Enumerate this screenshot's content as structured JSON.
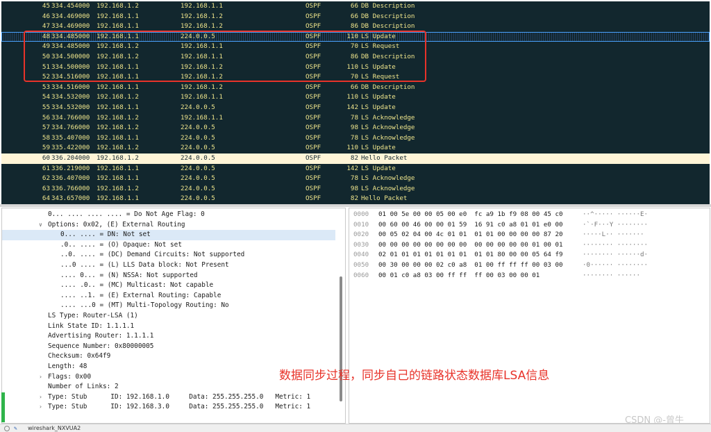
{
  "packets": [
    {
      "no": "45",
      "time": "334.454000",
      "src": "192.168.1.2",
      "dst": "192.168.1.1",
      "proto": "OSPF",
      "len": "66",
      "info": "DB Description"
    },
    {
      "no": "46",
      "time": "334.469000",
      "src": "192.168.1.1",
      "dst": "192.168.1.2",
      "proto": "OSPF",
      "len": "66",
      "info": "DB Description"
    },
    {
      "no": "47",
      "time": "334.469000",
      "src": "192.168.1.1",
      "dst": "192.168.1.2",
      "proto": "OSPF",
      "len": "86",
      "info": "DB Description"
    },
    {
      "no": "48",
      "time": "334.485000",
      "src": "192.168.1.1",
      "dst": "224.0.0.5",
      "proto": "OSPF",
      "len": "110",
      "info": "LS Update"
    },
    {
      "no": "49",
      "time": "334.485000",
      "src": "192.168.1.2",
      "dst": "192.168.1.1",
      "proto": "OSPF",
      "len": "70",
      "info": "LS Request"
    },
    {
      "no": "50",
      "time": "334.500000",
      "src": "192.168.1.2",
      "dst": "192.168.1.1",
      "proto": "OSPF",
      "len": "86",
      "info": "DB Description"
    },
    {
      "no": "51",
      "time": "334.500000",
      "src": "192.168.1.1",
      "dst": "192.168.1.2",
      "proto": "OSPF",
      "len": "110",
      "info": "LS Update"
    },
    {
      "no": "52",
      "time": "334.516000",
      "src": "192.168.1.1",
      "dst": "192.168.1.2",
      "proto": "OSPF",
      "len": "70",
      "info": "LS Request"
    },
    {
      "no": "53",
      "time": "334.516000",
      "src": "192.168.1.1",
      "dst": "192.168.1.2",
      "proto": "OSPF",
      "len": "66",
      "info": "DB Description"
    },
    {
      "no": "54",
      "time": "334.532000",
      "src": "192.168.1.2",
      "dst": "192.168.1.1",
      "proto": "OSPF",
      "len": "110",
      "info": "LS Update"
    },
    {
      "no": "55",
      "time": "334.532000",
      "src": "192.168.1.1",
      "dst": "224.0.0.5",
      "proto": "OSPF",
      "len": "142",
      "info": "LS Update"
    },
    {
      "no": "56",
      "time": "334.766000",
      "src": "192.168.1.2",
      "dst": "192.168.1.1",
      "proto": "OSPF",
      "len": "78",
      "info": "LS Acknowledge"
    },
    {
      "no": "57",
      "time": "334.766000",
      "src": "192.168.1.2",
      "dst": "224.0.0.5",
      "proto": "OSPF",
      "len": "98",
      "info": "LS Acknowledge"
    },
    {
      "no": "58",
      "time": "335.407000",
      "src": "192.168.1.1",
      "dst": "224.0.0.5",
      "proto": "OSPF",
      "len": "78",
      "info": "LS Acknowledge"
    },
    {
      "no": "59",
      "time": "335.422000",
      "src": "192.168.1.2",
      "dst": "224.0.0.5",
      "proto": "OSPF",
      "len": "110",
      "info": "LS Update"
    },
    {
      "no": "60",
      "time": "336.204000",
      "src": "192.168.1.2",
      "dst": "224.0.0.5",
      "proto": "OSPF",
      "len": "82",
      "info": "Hello Packet"
    },
    {
      "no": "61",
      "time": "336.219000",
      "src": "192.168.1.1",
      "dst": "224.0.0.5",
      "proto": "OSPF",
      "len": "142",
      "info": "LS Update"
    },
    {
      "no": "62",
      "time": "336.407000",
      "src": "192.168.1.1",
      "dst": "224.0.0.5",
      "proto": "OSPF",
      "len": "78",
      "info": "LS Acknowledge"
    },
    {
      "no": "63",
      "time": "336.766000",
      "src": "192.168.1.2",
      "dst": "224.0.0.5",
      "proto": "OSPF",
      "len": "98",
      "info": "LS Acknowledge"
    },
    {
      "no": "64",
      "time": "343.657000",
      "src": "192.168.1.1",
      "dst": "224.0.0.5",
      "proto": "OSPF",
      "len": "82",
      "info": "Hello Packet"
    }
  ],
  "details": [
    {
      "indent": 1,
      "twisty": "",
      "text": "0... .... .... .... = Do Not Age Flag: 0"
    },
    {
      "indent": 0,
      "twisty": "v",
      "text": "Options: 0x02, (E) External Routing"
    },
    {
      "indent": 2,
      "twisty": "",
      "text": "0... .... = DN: Not set"
    },
    {
      "indent": 2,
      "twisty": "",
      "text": ".0.. .... = (O) Opaque: Not set"
    },
    {
      "indent": 2,
      "twisty": "",
      "text": "..0. .... = (DC) Demand Circuits: Not supported"
    },
    {
      "indent": 2,
      "twisty": "",
      "text": "...0 .... = (L) LLS Data block: Not Present"
    },
    {
      "indent": 2,
      "twisty": "",
      "text": ".... 0... = (N) NSSA: Not supported"
    },
    {
      "indent": 2,
      "twisty": "",
      "text": ".... .0.. = (MC) Multicast: Not capable"
    },
    {
      "indent": 2,
      "twisty": "",
      "text": ".... ..1. = (E) External Routing: Capable"
    },
    {
      "indent": 2,
      "twisty": "",
      "text": ".... ...0 = (MT) Multi-Topology Routing: No"
    },
    {
      "indent": 0,
      "twisty": "",
      "text": "LS Type: Router-LSA (1)"
    },
    {
      "indent": 0,
      "twisty": "",
      "text": "Link State ID: 1.1.1.1"
    },
    {
      "indent": 0,
      "twisty": "",
      "text": "Advertising Router: 1.1.1.1"
    },
    {
      "indent": 0,
      "twisty": "",
      "text": "Sequence Number: 0x80000005"
    },
    {
      "indent": 0,
      "twisty": "",
      "text": "Checksum: 0x64f9"
    },
    {
      "indent": 0,
      "twisty": "",
      "text": "Length: 48"
    },
    {
      "indent": 0,
      "twisty": ">",
      "text": "Flags: 0x00"
    },
    {
      "indent": 0,
      "twisty": "",
      "text": "Number of Links: 2"
    },
    {
      "indent": 0,
      "twisty": ">",
      "text": "Type: Stub      ID: 192.168.1.0     Data: 255.255.255.0   Metric: 1"
    },
    {
      "indent": 0,
      "twisty": ">",
      "text": "Type: Stub      ID: 192.168.3.0     Data: 255.255.255.0   Metric: 1"
    }
  ],
  "bytes": [
    {
      "offset": "0000",
      "hex": "01 00 5e 00 00 05 00 e0  fc a9 1b f9 08 00 45 c0",
      "ascii": "··^····· ······E·"
    },
    {
      "offset": "0010",
      "hex": "00 60 00 46 00 00 01 59  16 91 c0 a8 01 01 e0 00",
      "ascii": "·`·F···Y ········"
    },
    {
      "offset": "0020",
      "hex": "00 05 02 04 00 4c 01 01  01 01 00 00 00 00 87 20",
      "ascii": "·····L·· ······· "
    },
    {
      "offset": "0030",
      "hex": "00 00 00 00 00 00 00 00  00 00 00 00 00 01 00 01",
      "ascii": "········ ········"
    },
    {
      "offset": "0040",
      "hex": "02 01 01 01 01 01 01 01  01 01 80 00 00 05 64 f9",
      "ascii": "········ ······d·"
    },
    {
      "offset": "0050",
      "hex": "00 30 00 00 00 02 c0 a8  01 00 ff ff ff 00 03 00",
      "ascii": "·0······ ········"
    },
    {
      "offset": "0060",
      "hex": "00 01 c0 a8 03 00 ff ff  ff 00 03 00 00 01",
      "ascii": "········ ······"
    }
  ],
  "annotation": "数据同步过程，同步自己的链路状态数据库LSA信息",
  "watermark": "CSDN @-曾牛",
  "status_text": "wireshark_NXVUA2",
  "colors": {
    "ospf_bg": "#12272e",
    "ospf_fg": "#f0e68c",
    "hello_bg": "#fff5d7",
    "highlight": "#e8332a",
    "selection": "#dbe9f7"
  }
}
